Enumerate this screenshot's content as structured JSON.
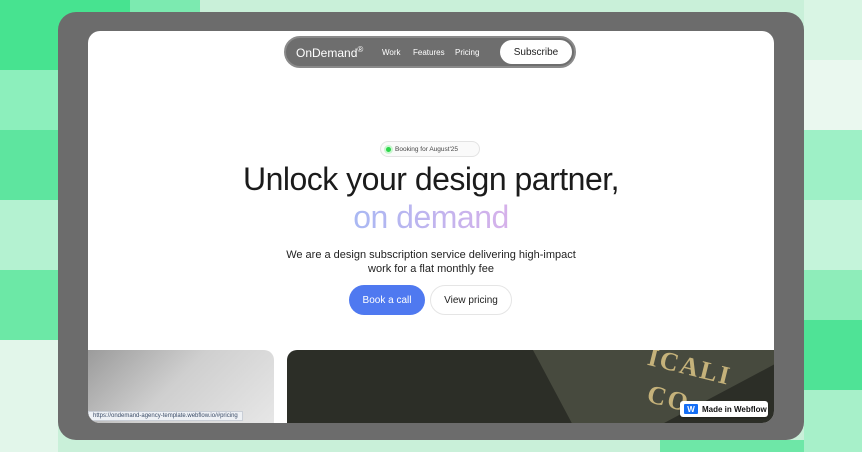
{
  "nav": {
    "brand": "OnDemand",
    "brand_mark": "®",
    "links": [
      "Work",
      "Features",
      "Pricing"
    ],
    "subscribe_label": "Subscribe"
  },
  "hero": {
    "badge": "Booking for August'25",
    "title_line1": "Unlock your design partner,",
    "title_line2": "on demand",
    "subtitle": "We are a design subscription service delivering high-impact work for a flat monthly fee",
    "primary_cta": "Book a call",
    "secondary_cta": "View pricing"
  },
  "cards": {
    "gold_text_1": "ICALI",
    "gold_text_2": "CO"
  },
  "status_url": "https://ondemand-agency-template.webflow.io/#pricing",
  "webflow_badge": "Made in Webflow",
  "colors": {
    "accent": "#4f79f0",
    "gradient_start": "#a9b8f3",
    "gradient_end": "#d6b1ea",
    "frame": "#6c6c6c",
    "background_green": "#3fe08a"
  }
}
